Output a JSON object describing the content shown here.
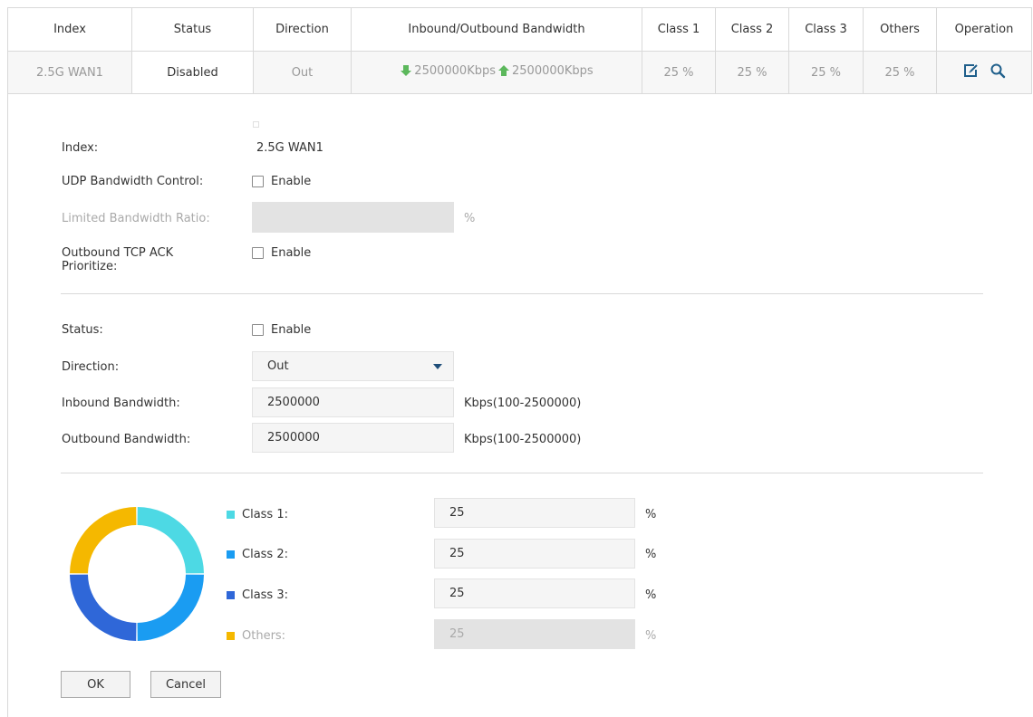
{
  "table": {
    "headers": [
      "Index",
      "Status",
      "Direction",
      "Inbound/Outbound Bandwidth",
      "Class 1",
      "Class 2",
      "Class 3",
      "Others",
      "Operation"
    ],
    "row": {
      "index": "2.5G WAN1",
      "status": "Disabled",
      "direction": "Out",
      "inbound": "2500000Kbps",
      "outbound": "2500000Kbps",
      "class1": "25 %",
      "class2": "25 %",
      "class3": "25 %",
      "others": "25 %"
    },
    "icons": {
      "inbound": "arrow-down-icon",
      "outbound": "arrow-up-icon",
      "edit": "edit-icon",
      "detail": "search-icon"
    }
  },
  "form": {
    "index_label": "Index:",
    "index_value": "2.5G WAN1",
    "udp_label": "UDP Bandwidth Control:",
    "udp_enable": "Enable",
    "ratio_label": "Limited Bandwidth Ratio:",
    "ratio_value": "",
    "ratio_unit": "%",
    "ack_label_line1": "Outbound TCP ACK",
    "ack_label_line2": "Prioritize:",
    "ack_enable": "Enable",
    "status_label": "Status:",
    "status_enable": "Enable",
    "direction_label": "Direction:",
    "direction_value": "Out",
    "inbound_label": "Inbound Bandwidth:",
    "inbound_value": "2500000",
    "inbound_unit": "Kbps(100-2500000)",
    "outbound_label": "Outbound Bandwidth:",
    "outbound_value": "2500000",
    "outbound_unit": "Kbps(100-2500000)",
    "classes": [
      {
        "label": "Class 1:",
        "value": "25",
        "unit": "%",
        "color": "#4dd9e4"
      },
      {
        "label": "Class 2:",
        "value": "25",
        "unit": "%",
        "color": "#1a9cf2"
      },
      {
        "label": "Class 3:",
        "value": "25",
        "unit": "%",
        "color": "#2f67d8"
      },
      {
        "label": "Others:",
        "value": "25",
        "unit": "%",
        "color": "#f5b800"
      }
    ],
    "ok_label": "OK",
    "cancel_label": "Cancel"
  },
  "chart_data": {
    "type": "pie",
    "categories": [
      "Class 1",
      "Class 2",
      "Class 3",
      "Others"
    ],
    "values": [
      25,
      25,
      25,
      25
    ],
    "colors": [
      "#4dd9e4",
      "#1a9cf2",
      "#2f67d8",
      "#f5b800"
    ]
  }
}
